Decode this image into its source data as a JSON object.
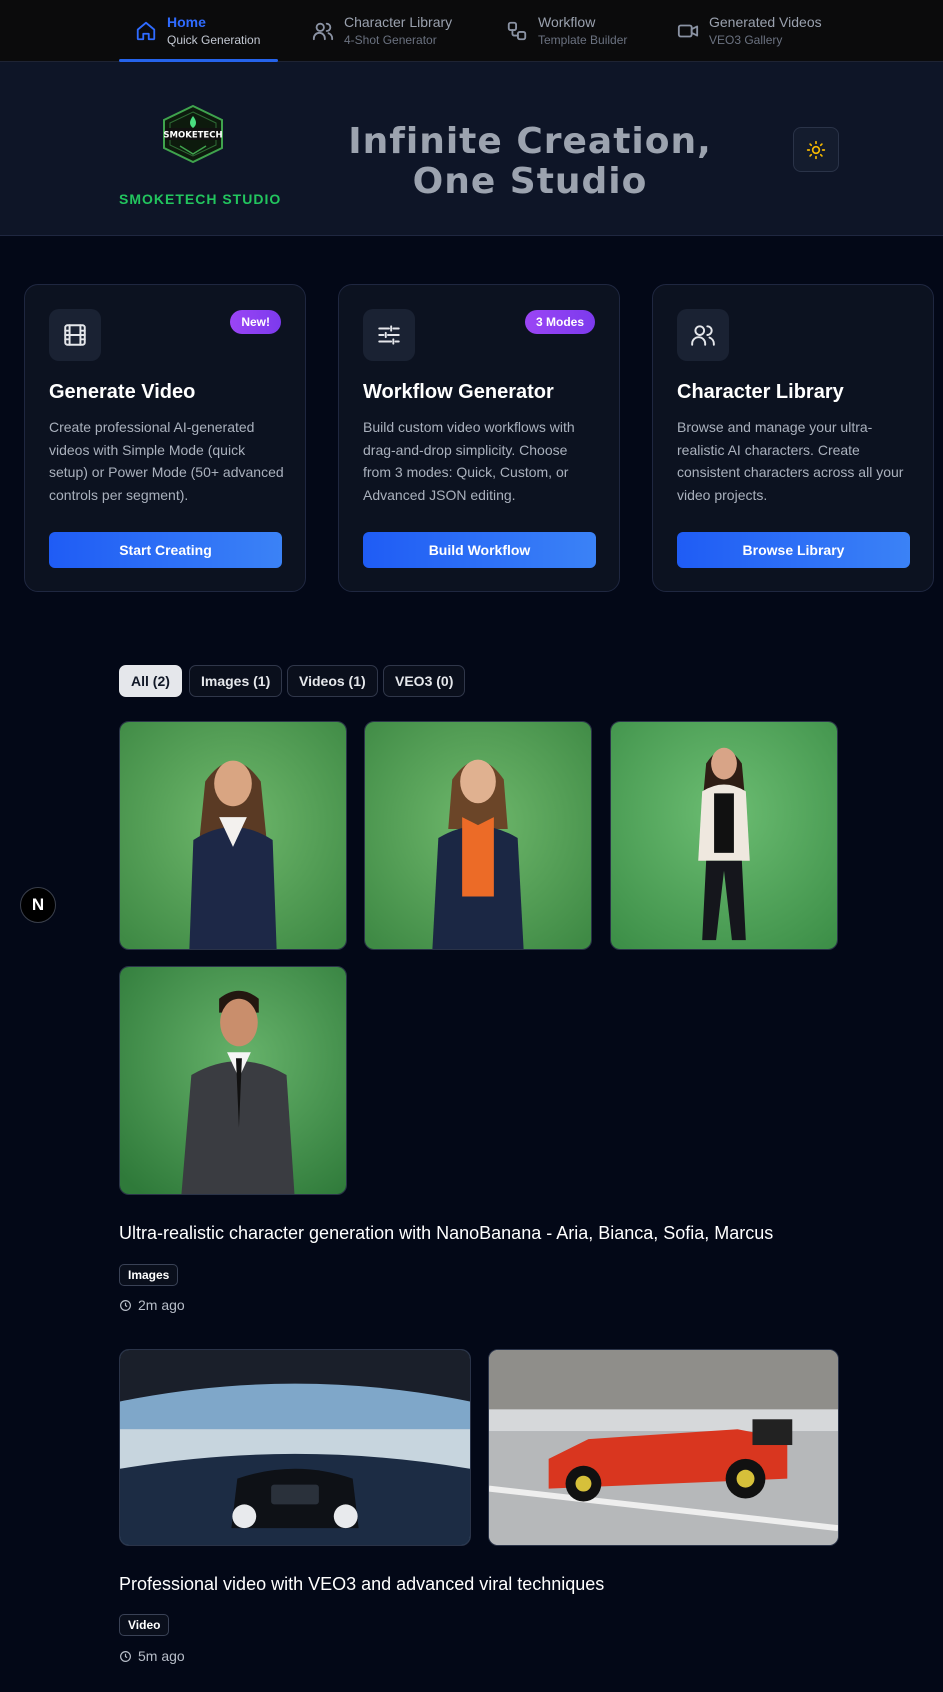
{
  "nav": {
    "items": [
      {
        "title": "Home",
        "sub": "Quick Generation",
        "icon": "home-icon"
      },
      {
        "title": "Character Library",
        "sub": "4-Shot Generator",
        "icon": "users-icon"
      },
      {
        "title": "Workflow",
        "sub": "Template Builder",
        "icon": "workflow-icon"
      },
      {
        "title": "Generated Videos",
        "sub": "VEO3 Gallery",
        "icon": "video-icon"
      }
    ]
  },
  "hero": {
    "logo_badge_text": "SMOKETECH",
    "logo_text": "SMOKETECH STUDIO",
    "title": "Infinite Creation, One Studio",
    "theme_icon": "sun-icon"
  },
  "cards": [
    {
      "icon": "film-icon",
      "badge": "New!",
      "title": "Generate Video",
      "desc": "Create professional AI-generated videos with Simple Mode (quick setup) or Power Mode (50+ advanced controls per segment).",
      "button": "Start Creating"
    },
    {
      "icon": "sliders-icon",
      "badge": "3 Modes",
      "title": "Workflow Generator",
      "desc": "Build custom video workflows with drag-and-drop simplicity. Choose from 3 modes: Quick, Custom, or Advanced JSON editing.",
      "button": "Build Workflow"
    },
    {
      "icon": "users-icon",
      "badge": "",
      "title": "Character Library",
      "desc": "Browse and manage your ultra-realistic AI characters. Create consistent characters across all your video projects.",
      "button": "Browse Library"
    }
  ],
  "filters": [
    "All (2)",
    "Images (1)",
    "Videos (1)",
    "VEO3 (0)"
  ],
  "posts": [
    {
      "title": "Ultra-realistic character generation with NanoBanana - Aria, Bianca, Sofia, Marcus",
      "tag": "Images",
      "time": "2m ago"
    },
    {
      "title": "Professional video with VEO3 and advanced viral techniques",
      "tag": "Video",
      "time": "5m ago"
    }
  ],
  "dev_badge": "N",
  "colors": {
    "accent": "#2563eb",
    "brand_green": "#22c55e",
    "badge_purple": "#9b45f5",
    "background": "#030817"
  }
}
